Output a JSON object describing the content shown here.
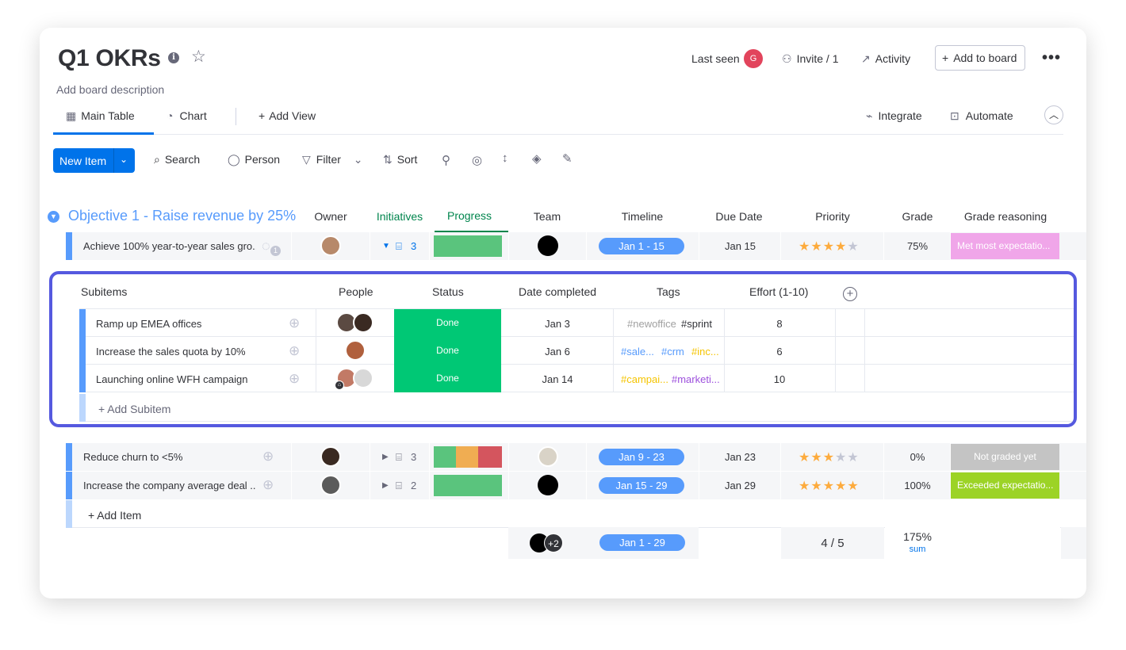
{
  "board": {
    "title": "Q1 OKRs",
    "description": "Add board description",
    "last_seen_label": "Last seen",
    "last_seen_avatar": "G",
    "invite_label": "Invite / 1",
    "activity_label": "Activity",
    "add_to_board_label": "Add to board"
  },
  "views": {
    "main_table": "Main Table",
    "chart": "Chart",
    "add_view": "Add View",
    "integrate": "Integrate",
    "automate": "Automate"
  },
  "toolbar": {
    "new_item": "New Item",
    "search": "Search",
    "person": "Person",
    "filter": "Filter",
    "sort": "Sort"
  },
  "group": {
    "title": "Objective 1 - Raise revenue by 25%",
    "color": "#579bfc",
    "columns": [
      "Owner",
      "Initiatives",
      "Progress",
      "Team",
      "Timeline",
      "Due Date",
      "Priority",
      "Grade",
      "Grade reasoning"
    ]
  },
  "items": [
    {
      "name": "Achieve 100% year-to-year sales gro...",
      "update_count": "1",
      "initiatives": "3",
      "timeline": "Jan 1 - 15",
      "due": "Jan 15",
      "priority": 4,
      "grade": "75%",
      "reasoning": "Met most expectatio...",
      "reasoning_color": "#f0a6e9",
      "progress": [
        {
          "color": "#5ac47d",
          "share": 1
        }
      ]
    },
    {
      "name": "Reduce churn to <5%",
      "initiatives": "3",
      "timeline": "Jan 9 - 23",
      "due": "Jan 23",
      "priority": 3,
      "grade": "0%",
      "reasoning": "Not graded yet",
      "reasoning_color": "#c4c4c4",
      "progress": [
        {
          "color": "#5ac47d",
          "share": 0.33
        },
        {
          "color": "#f0ad52",
          "share": 0.33
        },
        {
          "color": "#d4555e",
          "share": 0.34
        }
      ]
    },
    {
      "name": "Increase the company average deal ...",
      "initiatives": "2",
      "timeline": "Jan 15 - 29",
      "due": "Jan 29",
      "priority": 5,
      "grade": "100%",
      "reasoning": "Exceeded expectatio...",
      "reasoning_color": "#9cd326",
      "progress": [
        {
          "color": "#5ac47d",
          "share": 1
        }
      ]
    }
  ],
  "add_item": "+ Add Item",
  "subitems": {
    "columns": [
      "Subitems",
      "People",
      "Status",
      "Date completed",
      "Tags",
      "Effort (1-10)"
    ],
    "rows": [
      {
        "name": "Ramp up EMEA offices",
        "status": "Done",
        "date": "Jan 3",
        "tag1": "#newoffice",
        "tag1_color": "#a0a0a0",
        "tag2": "#sprint",
        "tag2_color": "#323338",
        "tag3": "",
        "tag3_color": "#323338",
        "effort": "8"
      },
      {
        "name": "Increase the sales quota by 10%",
        "status": "Done",
        "date": "Jan 6",
        "tag1": "#sale...",
        "tag1_color": "#579bfc",
        "tag2": "#crm",
        "tag2_color": "#579bfc",
        "tag3": "#inc...",
        "tag3_color": "#f5c400",
        "effort": "6"
      },
      {
        "name": "Launching online WFH campaign",
        "status": "Done",
        "date": "Jan 14",
        "tag1": "#campai...",
        "tag1_color": "#f5c400",
        "tag2": "#marketi...",
        "tag2_color": "#9d50dd",
        "tag3": "",
        "tag3_color": "#323338",
        "effort": "10"
      }
    ],
    "add_subitem": "+ Add Subitem"
  },
  "summary": {
    "team_extra": "+2",
    "timeline": "Jan 1 - 29",
    "priority": "4 / 5",
    "grade": "175%",
    "grade_label": "sum"
  }
}
